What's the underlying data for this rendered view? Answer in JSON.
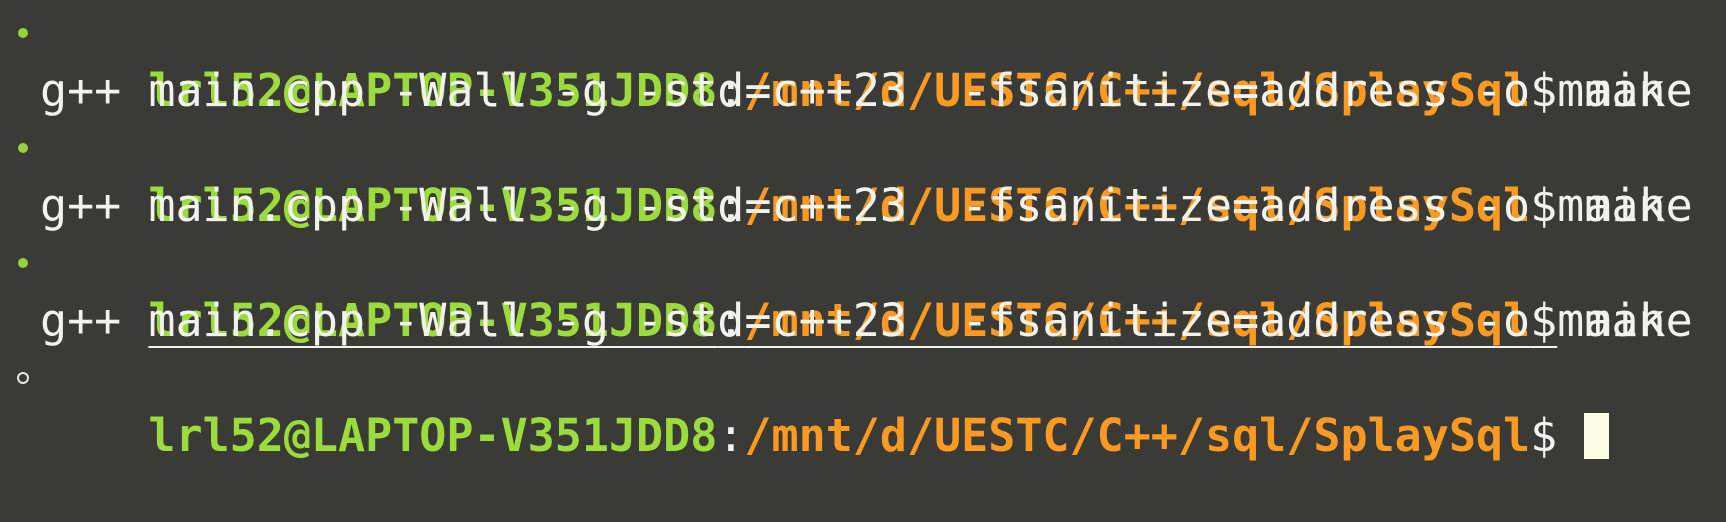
{
  "theme": {
    "background": "#3a3b37",
    "user_host_color": "#9bdc3c",
    "path_color": "#fb9a22",
    "text_color": "#f2f2ec",
    "cursor_color": "#fbfbe6",
    "success_marker_color": "#96d33a"
  },
  "prompt": {
    "user_host": "lrl52@LAPTOP-V351JDD8",
    "separator": ":",
    "path": "/mnt/d/UESTC/C++/sql/SplaySql",
    "symbol": "$"
  },
  "history": [
    {
      "marker": "filled-dot",
      "command": "make",
      "output": "g++ main.cpp -Wall -g -std=c++23  -fsanitize=address -o main"
    },
    {
      "marker": "filled-dot",
      "command": "make",
      "output": "g++ main.cpp -Wall -g -std=c++23  -fsanitize=address -o main"
    },
    {
      "marker": "filled-dot",
      "command": "make",
      "output": "g++ main.cpp -Wall -g -std=c++23  -fsanitize=address -o main"
    }
  ],
  "current": {
    "marker": "hollow-dot",
    "command": ""
  }
}
